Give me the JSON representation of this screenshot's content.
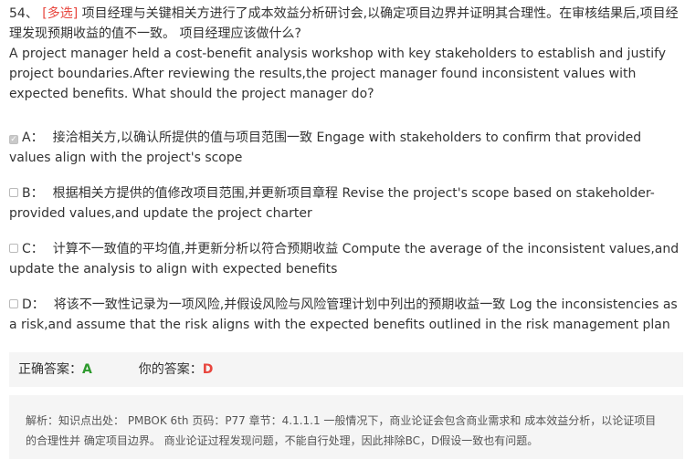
{
  "question": {
    "number": "54、",
    "tag": "[多选]",
    "text_cn": "项目经理与关键相关方进行了成本效益分析研讨会,以确定项目边界并证明其合理性。在审核结果后,项目经理发现预期收益的值不一致。 项目经理应该做什么?",
    "text_en": "A project manager held a cost-benefit analysis workshop with key stakeholders to establish and justify project boundaries.After reviewing the results,the project manager found inconsistent values with expected benefits. What should the project manager do?"
  },
  "options": [
    {
      "letter": "A：",
      "checked": true,
      "text": "接洽相关方,以确认所提供的值与项目范围一致 Engage with stakeholders to confirm that provided values align with the project's scope"
    },
    {
      "letter": "B：",
      "checked": false,
      "text": "根据相关方提供的值修改项目范围,并更新项目章程 Revise the project's scope based on stakeholder-provided values,and update the project charter"
    },
    {
      "letter": "C：",
      "checked": false,
      "text": "计算不一致值的平均值,并更新分析以符合预期收益 Compute the average of the inconsistent values,and update the analysis to align with expected benefits"
    },
    {
      "letter": "D：",
      "checked": false,
      "text": "将该不一致性记录为一项风险,并假设风险与风险管理计划中列出的预期收益一致 Log the inconsistencies as a risk,and assume that the risk aligns with the expected benefits outlined in the risk management plan"
    }
  ],
  "answer": {
    "correct_label": "正确答案：",
    "correct_value": "A",
    "yours_label": "你的答案：",
    "yours_value": "D"
  },
  "analysis": {
    "text": "解析：知识点出处： PMBOK 6th 页码：P77 章节：4.1.1.1 一般情况下，商业论证会包含商业需求和 成本效益分析，以论证项目的合理性并 确定项目边界。 商业论证过程发现问题，不能自行处理，因此排除BC，D假设一致也有问题。"
  },
  "colors": {
    "tag": "#e8463e",
    "correct": "#2d9a2d",
    "wrong": "#e8463e",
    "panel_bg": "#f5f5f5"
  }
}
